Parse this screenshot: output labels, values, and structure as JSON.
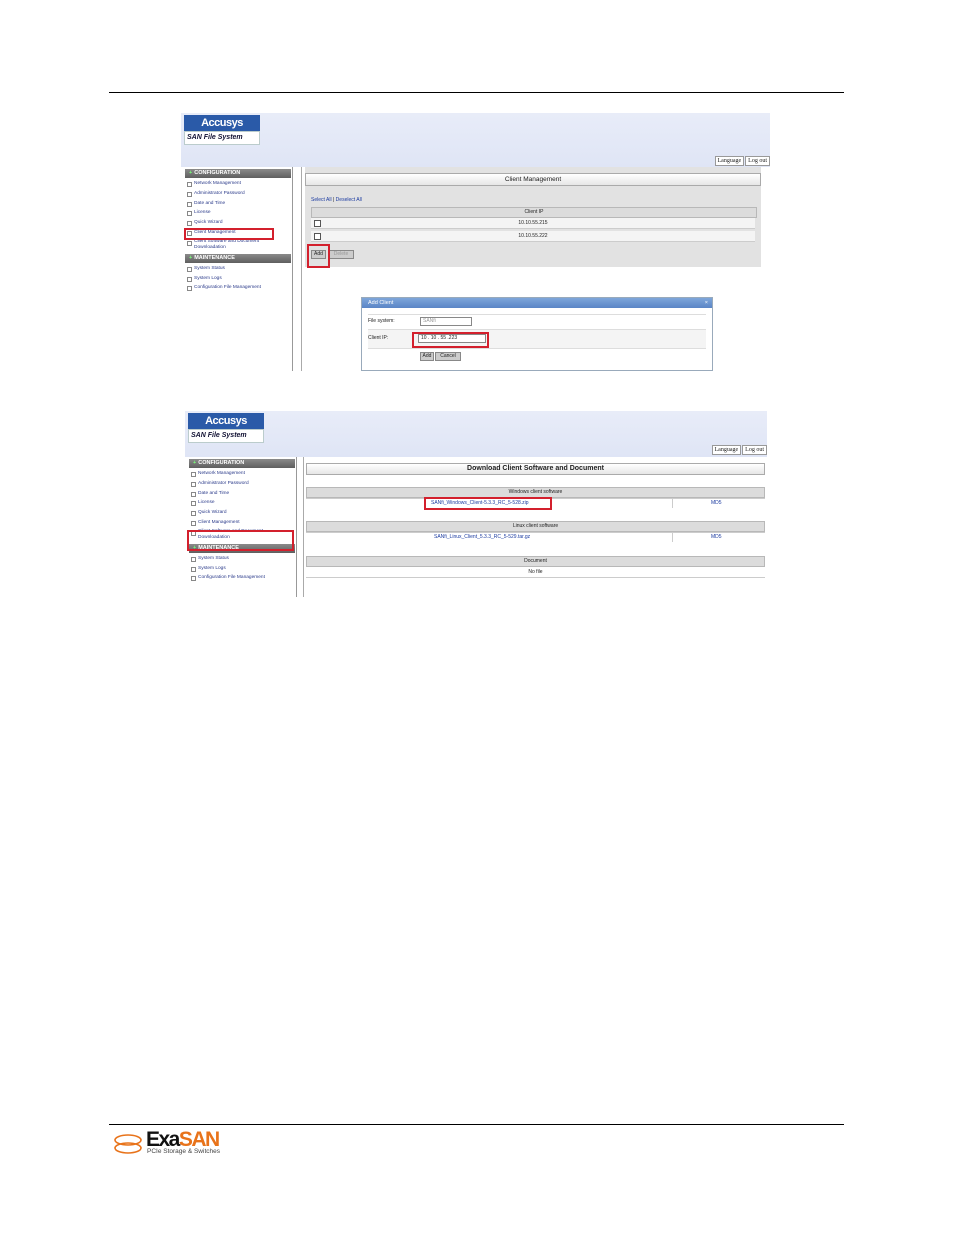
{
  "colors": {
    "highlight": "#d3202d",
    "brand_orange": "#e8731a",
    "nav_link": "#2a3a8a",
    "header_bg": "#e3e8f7",
    "dialog_title": "#6a93cf"
  },
  "app": {
    "logo_top": "Accusys",
    "logo_bottom": "SAN",
    "logo_bottom_suffix": "File System",
    "language": "Language",
    "logout": "Log out"
  },
  "sidebar": {
    "config_header": "CONFIGURATION",
    "maint_header": "MAINTENANCE",
    "config_items": [
      "Network Management",
      "Administrator Password",
      "Date and Time",
      "License",
      "Quick Wizard",
      "Client Management",
      "Client Software and Document Downloadation"
    ],
    "maint_items": [
      "System Status",
      "System Logs",
      "Configuration File Management"
    ]
  },
  "client_mgmt": {
    "title": "Client Management",
    "select_all": "Select All",
    "deselect_all": "Deselect All",
    "col_ip": "Client IP",
    "rows": [
      "10.10.55.215",
      "10.10.55.222"
    ],
    "add_label": "Add",
    "delete_label": "Delete"
  },
  "add_client": {
    "title": "Add Client",
    "close_icon": "close-icon",
    "fs_label": "File system:",
    "fs_value": "SANfi",
    "ip_label": "Client IP:",
    "ip_value": "10 . 10 . 55 .223",
    "add_label": "Add",
    "cancel_label": "Cancel"
  },
  "download": {
    "title": "Download Client Software and Document",
    "windows_header": "Windows client software",
    "windows_file": "SANfi_Windows_Client-5.3.3_RC_5-528.zip",
    "windows_md5": "MD5",
    "linux_header": "Linux client software",
    "linux_file": "SANfi_Linux_Client_5.3.3_RC_5-529.tar.gz",
    "linux_md5": "MD5",
    "doc_header": "Document",
    "doc_value": "No file"
  },
  "footer": {
    "brand_a": "Exa",
    "brand_b": "SAN",
    "tagline": "PCIe Storage & Switches"
  }
}
